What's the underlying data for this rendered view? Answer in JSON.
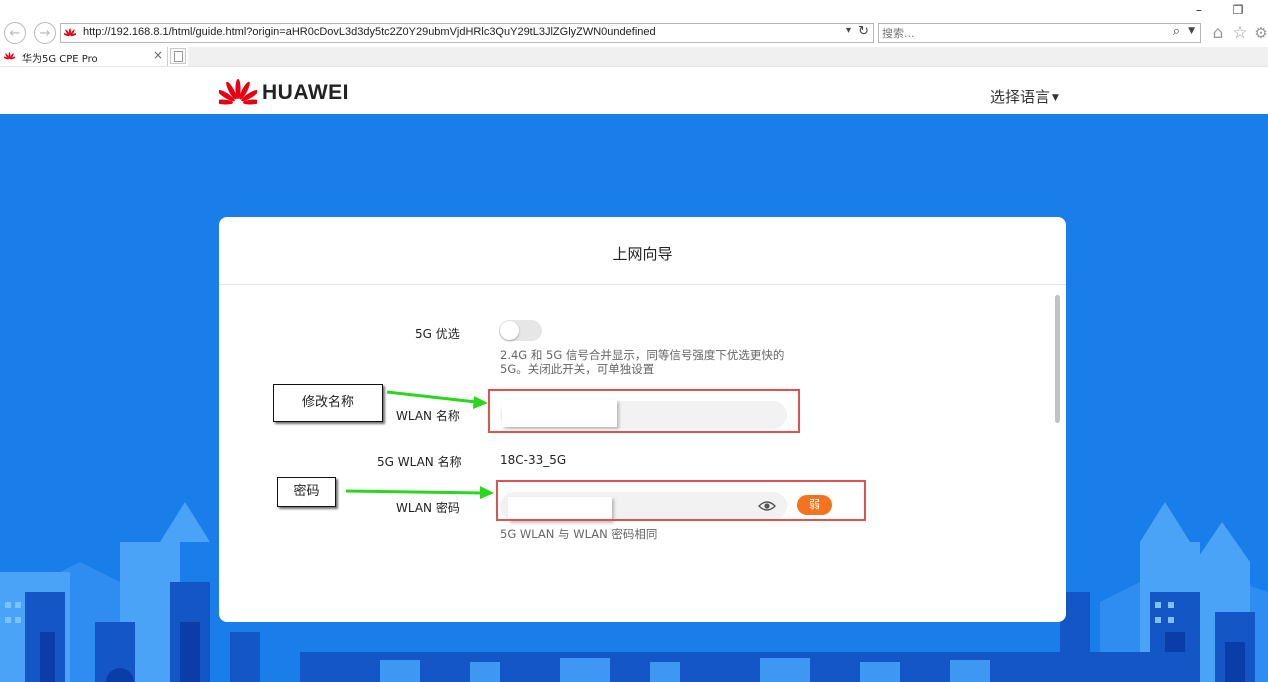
{
  "browser": {
    "url": "http://192.168.8.1/html/guide.html?origin=aHR0cDovL3d3dy5tc2Z0Y29ubmVjdHRlc3QuY29tL3JlZGlyZWN0undefined",
    "search_placeholder": "搜索...",
    "tab_title": "华为5G CPE Pro",
    "tab_close": "×",
    "minimize": "–",
    "restore": "❐",
    "icons": [
      "back-icon",
      "forward-icon",
      "refresh-icon",
      "search-icon",
      "home-icon",
      "favorites-icon",
      "settings-icon"
    ]
  },
  "header": {
    "brand": "HUAWEI",
    "language_label": "选择语言",
    "brand_color": "#e60012"
  },
  "card": {
    "title": "上网向导",
    "fiveg_priority_label": "5G 优选",
    "fiveg_priority_on": false,
    "fiveg_priority_hint": "2.4G 和 5G 信号合并显示，同等信号强度下优选更快的 5G。关闭此开关，可单独设置",
    "wlan_name_label": "WLAN 名称",
    "wlan_name_value": "",
    "fiveg_wlan_name_label": "5G WLAN 名称",
    "fiveg_wlan_name_value": "18C-33_5G",
    "wlan_password_label": "WLAN 密码",
    "wlan_password_value": "",
    "password_strength": "弱",
    "password_hint": "5G WLAN 与 WLAN 密码相同"
  },
  "annotations": {
    "rename_note": "修改名称",
    "password_note": "密码",
    "box_color": "#e05252",
    "arrow_color": "#2ad61e"
  },
  "colors": {
    "background_blue": "#1a7eea",
    "strength_weak": "#f5721f"
  }
}
